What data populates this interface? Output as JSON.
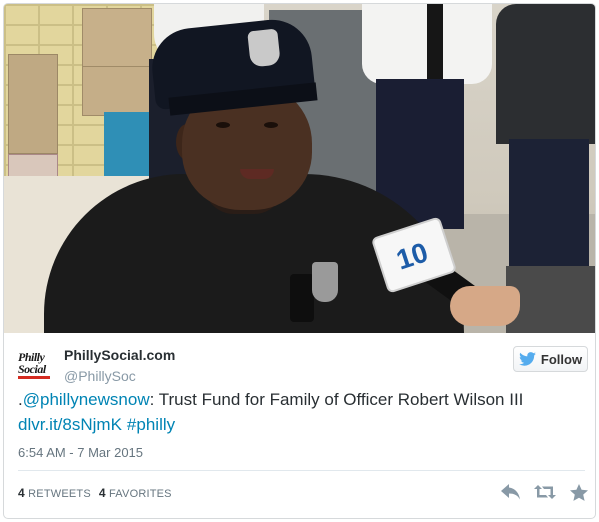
{
  "tweet": {
    "display_name": "PhillySocial.com",
    "handle": "@PhillySoc",
    "avatar_text": "Philly Social",
    "follow_label": "Follow",
    "text_prefix": ".",
    "mention": "@phillynewsnow",
    "text_body": ": Trust Fund for Family of Officer Robert Wilson III",
    "link": "dlvr.it/8sNjmK",
    "hashtag": "#philly",
    "timestamp": "6:54 AM - 7 Mar 2015",
    "retweets_count": "4",
    "retweets_label": "RETWEETS",
    "favorites_count": "4",
    "favorites_label": "FAVORITES"
  },
  "photo": {
    "mic_flag_text": "10"
  },
  "icons": {
    "follow": "twitter-bird-icon",
    "reply": "reply-icon",
    "retweet": "retweet-icon",
    "favorite": "star-icon"
  },
  "colors": {
    "link": "#0084b4",
    "text": "#292f33",
    "muted": "#66757f",
    "twitter_blue": "#55acee"
  }
}
